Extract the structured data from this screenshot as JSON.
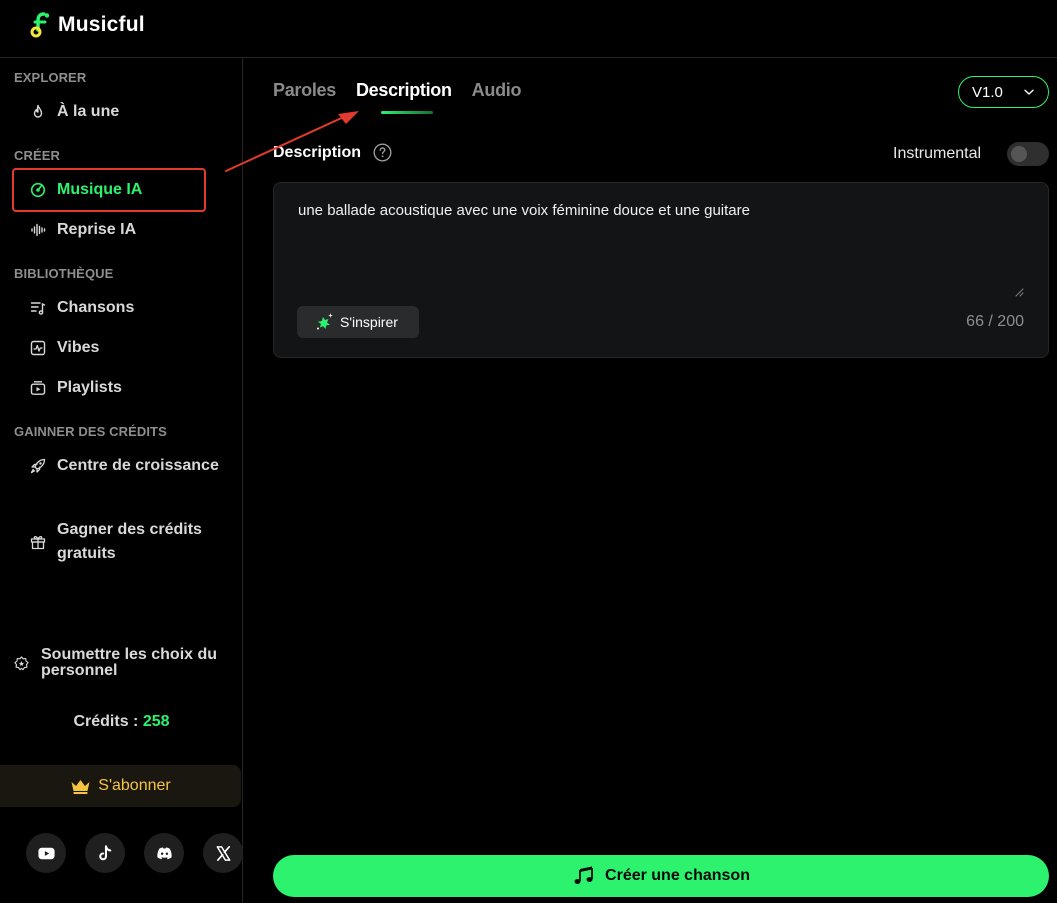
{
  "app": {
    "name": "Musicful",
    "accent_color": "#2cf26e"
  },
  "sidebar": {
    "sections": [
      {
        "title": "EXPLORER"
      },
      {
        "title": "CRÉER"
      },
      {
        "title": "BIBLIOTHÈQUE"
      },
      {
        "title": "GAINNER DES CRÉDITS"
      }
    ],
    "items": [
      {
        "label": "À la une",
        "icon": "flame-icon"
      },
      {
        "label": "Musique IA",
        "icon": "music-disc-icon",
        "active": true
      },
      {
        "label": "Reprise IA",
        "icon": "waveform-icon"
      },
      {
        "label": "Chansons",
        "icon": "song-list-icon"
      },
      {
        "label": "Vibes",
        "icon": "pulse-icon"
      },
      {
        "label": "Playlists",
        "icon": "playlist-icon"
      },
      {
        "label": "Centre de croissance",
        "icon": "rocket-icon"
      },
      {
        "label": "Gagner des crédits gratuits",
        "icon": "gift-icon"
      }
    ],
    "submit_choice": {
      "label": "Soumettre les choix du personnel",
      "icon": "badge-star-icon"
    },
    "credits": {
      "label": "Crédits : ",
      "value": "258"
    },
    "subscribe": {
      "label": "S'abonner",
      "icon": "crown-icon",
      "color": "#f5c441"
    },
    "socials": [
      "youtube-icon",
      "tiktok-icon",
      "discord-icon",
      "x-icon"
    ]
  },
  "main": {
    "tabs": [
      {
        "label": "Paroles",
        "active": false
      },
      {
        "label": "Description",
        "active": true
      },
      {
        "label": "Audio",
        "active": false
      }
    ],
    "version": {
      "value": "V1.0"
    },
    "description": {
      "label": "Description",
      "value": "une ballade acoustique avec une voix féminine douce et une guitare",
      "char_count": "66 / 200",
      "inspire_label": "S'inspirer"
    },
    "instrumental": {
      "label": "Instrumental",
      "enabled": false
    },
    "create_button": {
      "label": "Créer une chanson"
    }
  }
}
